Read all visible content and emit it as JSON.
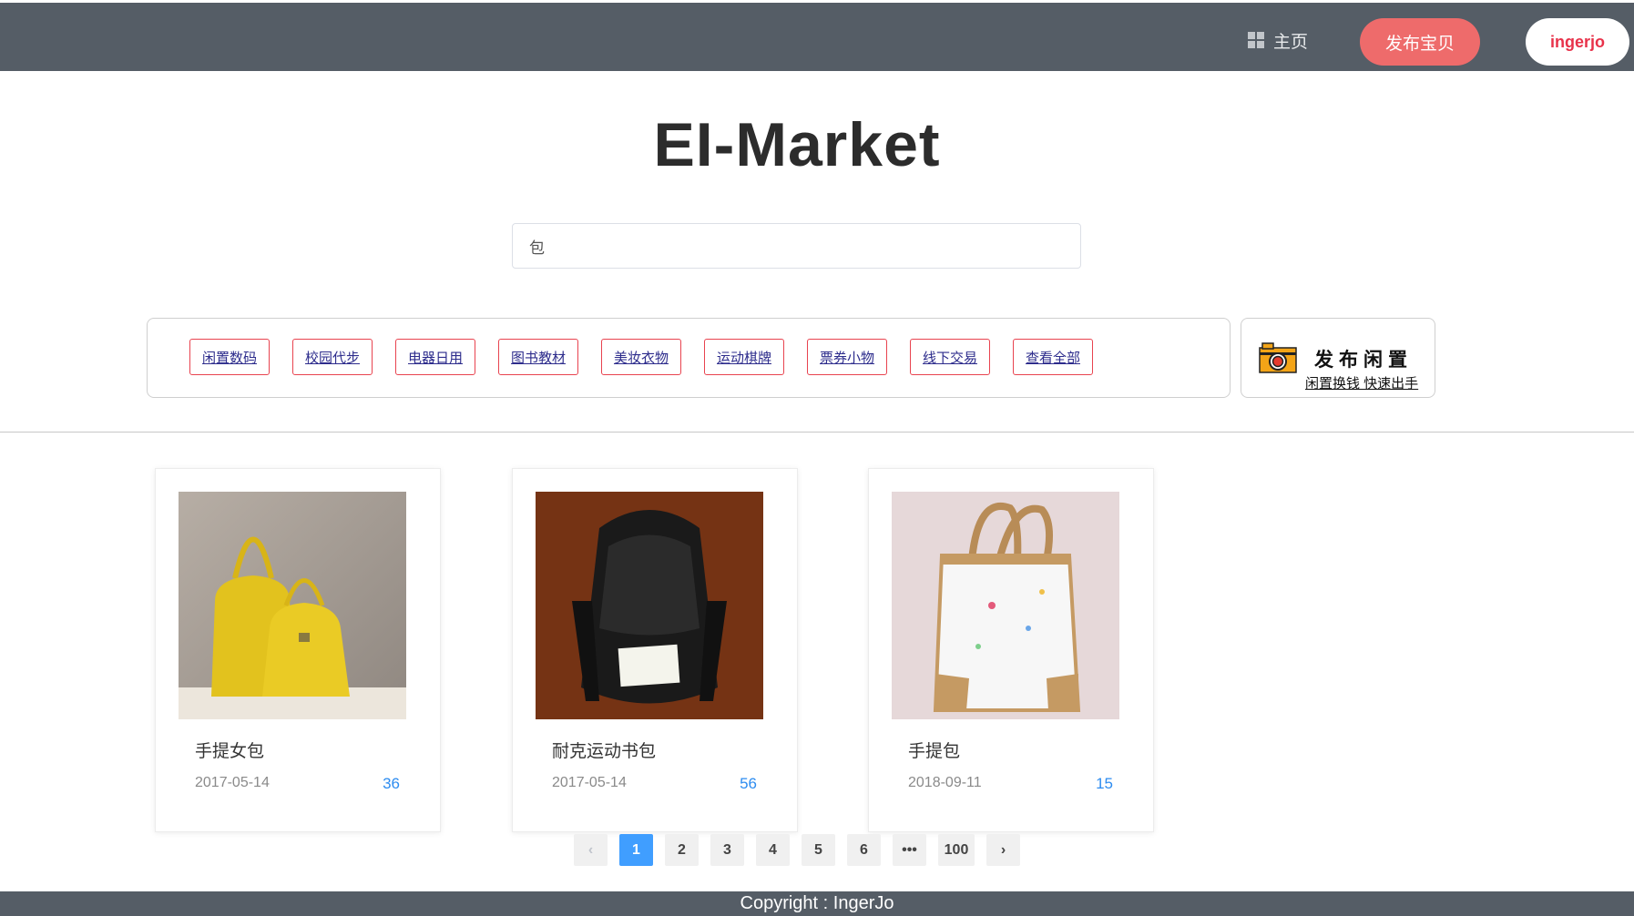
{
  "header": {
    "home_label": "主页",
    "publish_label": "发布宝贝",
    "user_label": "ingerjo"
  },
  "site": {
    "title": "EI-Market"
  },
  "search": {
    "value": "包",
    "placeholder": ""
  },
  "categories": [
    "闲置数码",
    "校园代步",
    "电器日用",
    "图书教材",
    "美妆衣物",
    "运动棋牌",
    "票券小物",
    "线下交易",
    "查看全部"
  ],
  "publish_card": {
    "title": "发布闲置",
    "subtitle": "闲置换钱 快速出手"
  },
  "products": [
    {
      "name": "手提女包",
      "date": "2017-05-14",
      "views": "36",
      "image": "yellow-handbags"
    },
    {
      "name": "耐克运动书包",
      "date": "2017-05-14",
      "views": "56",
      "image": "black-backpack"
    },
    {
      "name": "手提包",
      "date": "2018-09-11",
      "views": "15",
      "image": "white-tote-bag"
    }
  ],
  "pagination": {
    "prev": "‹",
    "pages": [
      "1",
      "2",
      "3",
      "4",
      "5",
      "6"
    ],
    "ellipsis": "•••",
    "last": "100",
    "next": "›",
    "current": "1"
  },
  "footer": {
    "text": "Copyright : IngerJo"
  },
  "colors": {
    "header_bg": "#555d66",
    "publish_button": "#ee6b6b",
    "accent_blue": "#409eff",
    "views_blue": "#2d8cf0",
    "category_border": "#e8434f"
  }
}
